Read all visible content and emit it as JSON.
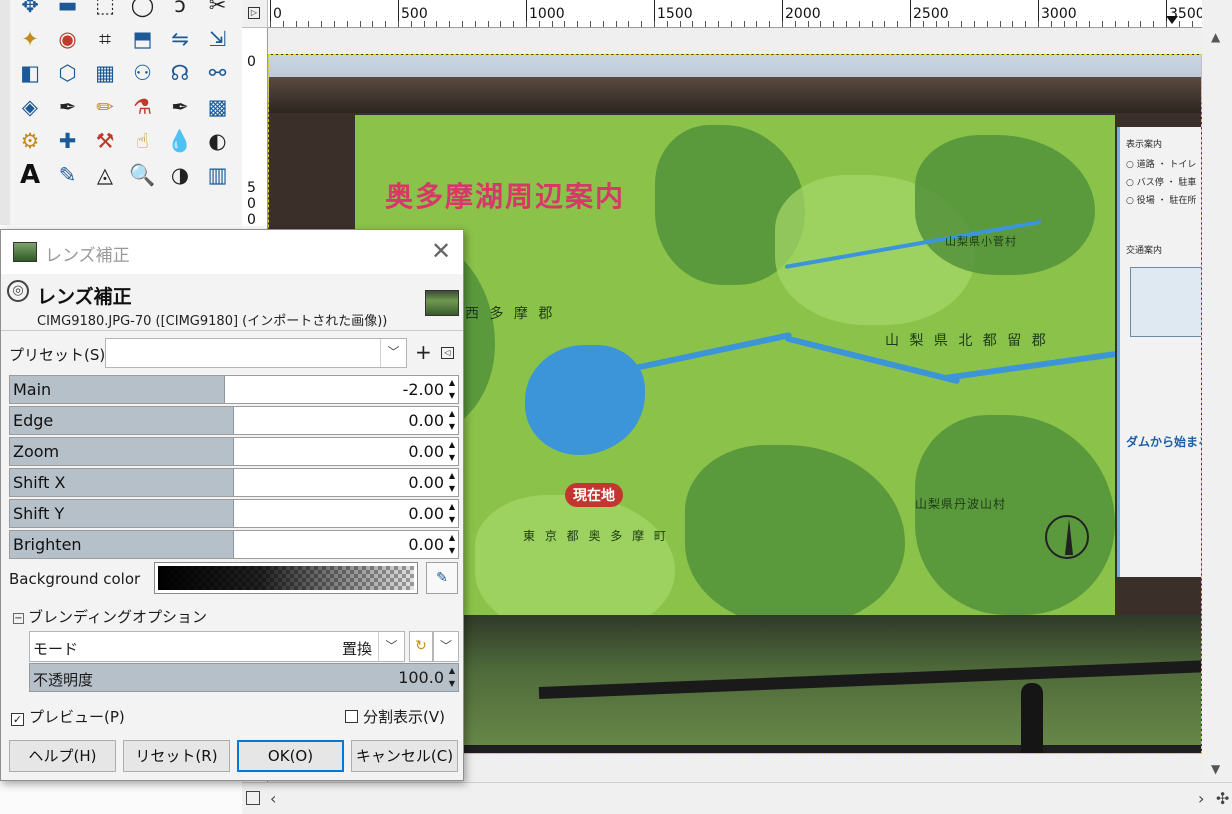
{
  "dialog": {
    "window_title": "レンズ補正",
    "header_title": "レンズ補正",
    "header_subtitle": "CIMG9180.JPG-70 ([CIMG9180] (インポートされた画像))",
    "close_glyph": "✕",
    "preset_label": "プリセット(S):",
    "preset_value": "",
    "preset_add": "+",
    "sliders": [
      {
        "name": "Main",
        "value": "-2.00",
        "fill_fraction": 0.48
      },
      {
        "name": "Edge",
        "value": "0.00",
        "fill_fraction": 0.5
      },
      {
        "name": "Zoom",
        "value": "0.00",
        "fill_fraction": 0.5
      },
      {
        "name": "Shift X",
        "value": "0.00",
        "fill_fraction": 0.5
      },
      {
        "name": "Shift Y",
        "value": "0.00",
        "fill_fraction": 0.5
      },
      {
        "name": "Brighten",
        "value": "0.00",
        "fill_fraction": 0.5
      }
    ],
    "background_color_label": "Background color",
    "blending_options_label": "ブレンディングオプション",
    "mode_label": "モード",
    "mode_value": "置換",
    "opacity_label": "不透明度",
    "opacity_value": "100.0",
    "opacity_fraction": 1.0,
    "preview_label": "プレビュー(P)",
    "preview_checked": true,
    "split_view_label": "分割表示(V)",
    "split_view_checked": false,
    "buttons": {
      "help": "ヘルプ(H)",
      "reset": "リセット(R)",
      "ok": "OK(O)",
      "cancel": "キャンセル(C)"
    }
  },
  "ruler": {
    "horizontal_labels": [
      "0",
      "500",
      "1000",
      "1500",
      "2000",
      "2500",
      "3000",
      "3500"
    ],
    "vertical_labels": [
      "0",
      "5",
      "0",
      "0"
    ]
  },
  "map": {
    "title": "奥多摩湖周辺案内",
    "current_location": "現在地",
    "labels": [
      "西 多 摩 郡",
      "山 梨 県 北 都 留 郡",
      "東 京 都 奥 多 摩 町",
      "山梨県丹波山村",
      "山梨県小菅村",
      "ダムから始まる"
    ]
  },
  "toolbox": {
    "tools": [
      "move-tool",
      "align-tool",
      "rect-select-tool",
      "ellipse-select-tool",
      "lasso-tool",
      "scissors-tool",
      "foreground-select-tool",
      "fuzzy-select-tool",
      "color-select-tool",
      "crop-tool",
      "transform-tool",
      "flip-tool",
      "scale-tool",
      "shear-tool",
      "perspective-tool",
      "3d-transform-tool",
      "grid-transform-tool",
      "cage-tool",
      "warp-tool",
      "path-tool",
      "paint-select-tool",
      "gradient-tool",
      "paintbrush-tool",
      "pencil-tool",
      "airbrush-tool",
      "ink-tool",
      "mypaint-tool",
      "eraser-tool",
      "clone-tool",
      "heal-tool",
      "perspective-clone-tool",
      "smudge-tool",
      "blur-tool",
      "dodge-tool",
      "bucket-fill-tool",
      "text-tool",
      "color-picker-tool",
      "measure-tool",
      "zoom-tool",
      "threshold-tool",
      "levels-tool",
      "curves-tool"
    ]
  },
  "colors": {
    "slider_fill": "#b6c0c9",
    "ok_border": "#0078d7",
    "map_green": "#8bc34a",
    "map_title": "#d6386a"
  }
}
